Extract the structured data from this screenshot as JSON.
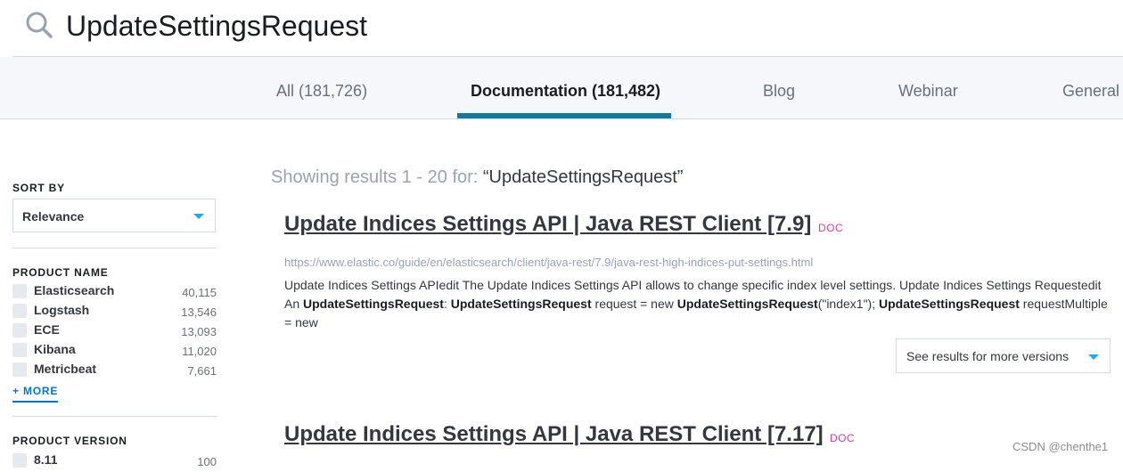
{
  "search": {
    "query": "UpdateSettingsRequest"
  },
  "tabs": [
    {
      "label": "All (181,726)",
      "active": false
    },
    {
      "label": "Documentation (181,482)",
      "active": true
    },
    {
      "label": "Blog",
      "active": false
    },
    {
      "label": "Webinar",
      "active": false
    },
    {
      "label": "General",
      "active": false
    }
  ],
  "sidebar": {
    "sort_by": {
      "heading": "SORT BY",
      "value": "Relevance"
    },
    "product_name": {
      "heading": "PRODUCT NAME",
      "items": [
        {
          "name": "Elasticsearch",
          "count": "40,115"
        },
        {
          "name": "Logstash",
          "count": "13,546"
        },
        {
          "name": "ECE",
          "count": "13,093"
        },
        {
          "name": "Kibana",
          "count": "11,020"
        },
        {
          "name": "Metricbeat",
          "count": "7,661"
        }
      ],
      "more_label": "+ MORE"
    },
    "product_version": {
      "heading": "PRODUCT VERSION",
      "items": [
        {
          "name": "8.11",
          "count": "100"
        }
      ]
    }
  },
  "results": {
    "showing_prefix": "Showing results 1 - 20 for: ",
    "showing_query": "“UpdateSettingsRequest”",
    "items": [
      {
        "title": "Update Indices Settings API | Java REST Client [7.9]",
        "badge": "DOC",
        "url": "https://www.elastic.co/guide/en/elasticsearch/client/java-rest/7.9/java-rest-high-indices-put-settings.html",
        "snippet": [
          {
            "text": "Update Indices Settings APIedit The Update Indices Settings API allows to change specific index level settings. Update Indices Settings Requestedit An ",
            "bold": false
          },
          {
            "text": "UpdateSettingsRequest",
            "bold": true
          },
          {
            "text": ": ",
            "bold": false
          },
          {
            "text": "UpdateSettingsRequest",
            "bold": true
          },
          {
            "text": " request = new ",
            "bold": false
          },
          {
            "text": "UpdateSettingsRequest",
            "bold": true
          },
          {
            "text": "(\"index1\"); ",
            "bold": false
          },
          {
            "text": "UpdateSettingsRequest",
            "bold": true
          },
          {
            "text": " requestMultiple = new",
            "bold": false
          }
        ],
        "versions_label": "See results for more versions"
      },
      {
        "title": "Update Indices Settings API | Java REST Client [7.17]",
        "badge": "DOC"
      }
    ]
  },
  "watermark": "CSDN @chenthe1",
  "colors": {
    "accent": "#0f7a9b",
    "link": "#0077cc",
    "badge": "#d6409f",
    "caret": "#1ba9f5"
  }
}
